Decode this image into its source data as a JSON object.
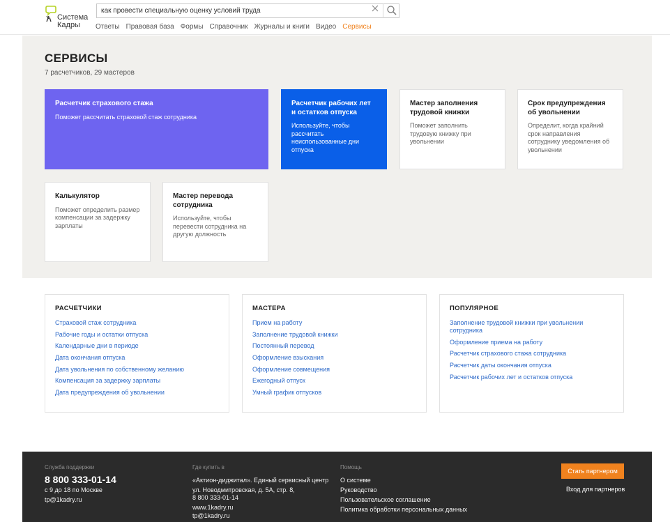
{
  "header": {
    "logo_line1": "Система",
    "logo_line2": "Кадры",
    "search_value": "как провести специальную оценку условий труда",
    "nav": [
      "Ответы",
      "Правовая база",
      "Формы",
      "Справочник",
      "Журналы и книги",
      "Видео",
      "Сервисы"
    ],
    "active_nav": "Сервисы",
    "accent_color": "#f0821e"
  },
  "hero": {
    "title": "СЕРВИСЫ",
    "subtitle": "7 расчетчиков, 29 мастеров"
  },
  "cards": [
    {
      "title": "Расчетчик страхового стажа",
      "desc": "Поможет рассчитать страховой стаж сотрудника",
      "color": "#6e64f0"
    },
    {
      "title": "Расчетчик рабочих лет и остатков отпуска",
      "desc": "Используйте, чтобы рассчитать неиспользованные дни отпуска",
      "color": "#0a5fe8"
    },
    {
      "title": "Мастер заполнения трудовой книжки",
      "desc": "Поможет заполнить трудовую книжку при увольнении"
    },
    {
      "title": "Срок предупреждения об увольнении",
      "desc": "Определит, когда крайний срок направления сотруднику уведомления об увольнении"
    },
    {
      "title": "Калькулятор",
      "desc": "Поможет определить размер компенсации за задержку зарплаты"
    },
    {
      "title": "Мастер перевода сотрудника",
      "desc": "Используйте, чтобы перевести сотрудника на другую должность"
    }
  ],
  "panels": {
    "calculators": {
      "title": "РАСЧЕТЧИКИ",
      "links": [
        "Страховой стаж сотрудника",
        "Рабочие годы и остатки отпуска",
        "Календарные дни в периоде",
        "Дата окончания отпуска",
        "Дата увольнения по собственному желанию",
        "Компенсация за задержку зарплаты",
        "Дата предупреждения об увольнении"
      ]
    },
    "masters": {
      "title": "МАСТЕРА",
      "links": [
        "Прием на работу",
        "Заполнение трудовой книжки",
        "Постоянный перевод",
        "Оформление взыскания",
        "Оформление совмещения",
        "Ежегодный отпуск",
        "Умный график отпусков"
      ]
    },
    "popular": {
      "title": "ПОПУЛЯРНОЕ",
      "links": [
        "Заполнение трудовой книжки при увольнении сотрудника",
        "Оформление приема на работу",
        "Расчетчик страхового стажа сотрудника",
        "Расчетчик даты окончания отпуска",
        "Расчетчик рабочих лет и остатков отпуска"
      ]
    }
  },
  "footer": {
    "support_label": "Служба поддержки",
    "phone": "8 800 333-01-14",
    "hours": "с 9 до 18 по Москве",
    "support_email": "tp@1kadry.ru",
    "buy_label": "Где купить в",
    "company": "«Актион-диджитал». Единый сервисный центр",
    "address": "ул. Новодмитровская, д. 5А, стр. 8,",
    "company_phone": "8 800 333-01-14",
    "site": "www.1kadry.ru",
    "buy_email": "tp@1kadry.ru",
    "help_label": "Помощь",
    "help_links": [
      "О системе",
      "Руководство",
      "Пользовательское соглашение",
      "Политика обработки персональных данных"
    ],
    "partner_button": "Стать партнером",
    "partner_login": "Вход для партнеров"
  }
}
